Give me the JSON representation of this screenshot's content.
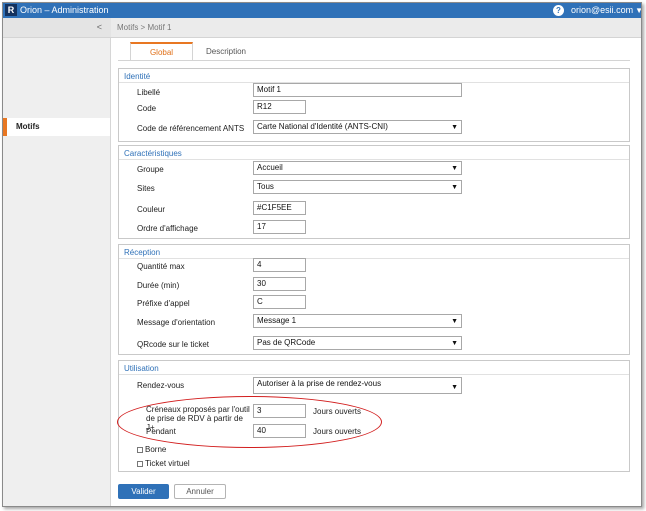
{
  "app": {
    "logo_letter": "R",
    "title": "Orion – Administration",
    "user": "orion@esii.com",
    "help_icon": "help-icon",
    "caret": "▼"
  },
  "sidebar": {
    "collapse": "<",
    "items": [
      {
        "label": "Motifs",
        "active": true
      }
    ]
  },
  "breadcrumb": "Motifs > Motif 1",
  "tabs": [
    {
      "label": "Global",
      "active": true
    },
    {
      "label": "Description",
      "active": false
    }
  ],
  "identite": {
    "title": "Identité",
    "libelle_label": "Libellé",
    "libelle_value": "Motif 1",
    "code_label": "Code",
    "code_value": "R12",
    "ants_label": "Code de référencement ANTS",
    "ants_value": "Carte National d'Identité (ANTS-CNI)"
  },
  "caracteristiques": {
    "title": "Caractéristiques",
    "groupe_label": "Groupe",
    "groupe_value": "Accueil",
    "sites_label": "Sites",
    "sites_value": "Tous",
    "couleur_label": "Couleur",
    "couleur_value": "#C1F5EE",
    "ordre_label": "Ordre d'affichage",
    "ordre_value": "17"
  },
  "reception": {
    "title": "Réception",
    "quantite_label": "Quantité max",
    "quantite_value": "4",
    "duree_label": "Durée (min)",
    "duree_value": "30",
    "prefixe_label": "Préfixe d'appel",
    "prefixe_value": "C",
    "message_label": "Message d'orientation",
    "message_value": "Message 1",
    "qrcode_label": "QRcode sur le ticket",
    "qrcode_value": "Pas de QRCode"
  },
  "utilisation": {
    "title": "Utilisation",
    "rdv_label": "Rendez-vous",
    "rdv_value": "Autoriser à la prise de rendez-vous",
    "creneaux_label": "Créneaux proposés par l'outil de prise de RDV à partir de J+",
    "creneaux_value": "3",
    "creneaux_unit": "Jours ouverts",
    "pendant_label": "Pendant",
    "pendant_value": "40",
    "pendant_unit": "Jours ouverts",
    "borne_label": "Borne",
    "borne_checked": false,
    "ticket_label": "Ticket virtuel",
    "ticket_checked": false
  },
  "actions": {
    "valider": "Valider",
    "annuler": "Annuler"
  },
  "colors": {
    "topbar": "#2f71b8",
    "accent": "#e87722",
    "section_title": "#2f71b8",
    "highlight": "#d21f1f"
  }
}
